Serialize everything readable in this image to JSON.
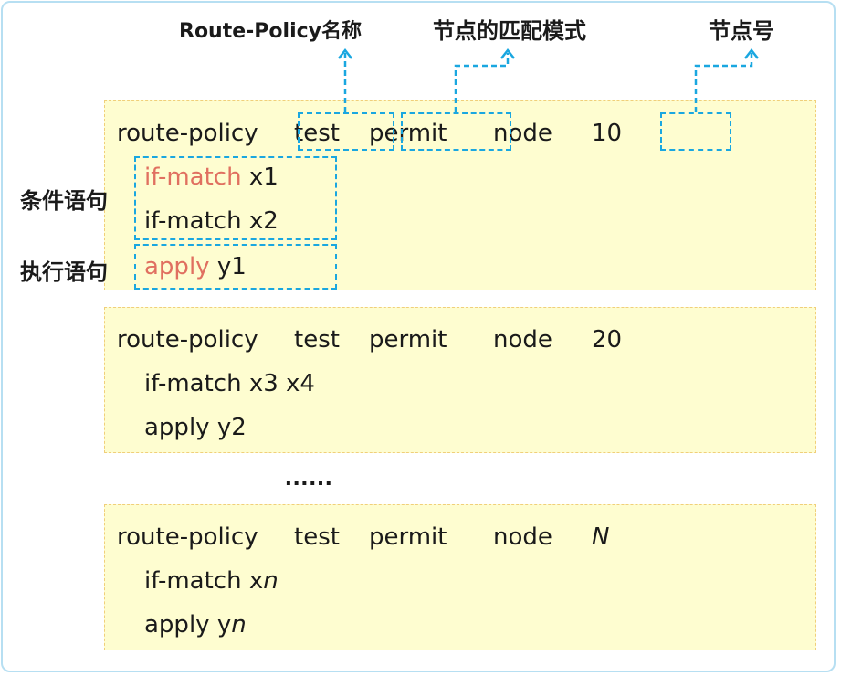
{
  "labels": {
    "policy_name": "Route-Policy名称",
    "match_mode": "节点的匹配模式",
    "node_number": "节点号",
    "condition": "条件语句",
    "action": "执行语句"
  },
  "blocks": [
    {
      "route_policy": "route-policy",
      "name": "test",
      "mode": "permit",
      "node_kw": "node",
      "node_num": "10",
      "conditions": [
        {
          "kw": "if-match",
          "arg": "x1"
        },
        {
          "kw": "if-match",
          "arg": "x2"
        }
      ],
      "apply_kw": "apply",
      "apply_arg": "y1"
    },
    {
      "route_policy": "route-policy",
      "name": "test",
      "mode": "permit",
      "node_kw": "node",
      "node_num": "20",
      "condition_line": "if-match x3 x4",
      "apply_line": "apply y2"
    },
    {
      "route_policy": "route-policy",
      "name": "test",
      "mode": "permit",
      "node_kw": "node",
      "node_num": "N",
      "condition_prefix": "if-match x",
      "condition_var": "n",
      "apply_prefix": "apply y",
      "apply_var": "n"
    }
  ],
  "ellipsis": "......",
  "colors": {
    "keyword_highlight": "#e07060",
    "dashed_box": "#1aa7e0",
    "block_fill": "#fefdd0",
    "block_border": "#f0cf7a",
    "frame_border": "#b7dff2"
  }
}
